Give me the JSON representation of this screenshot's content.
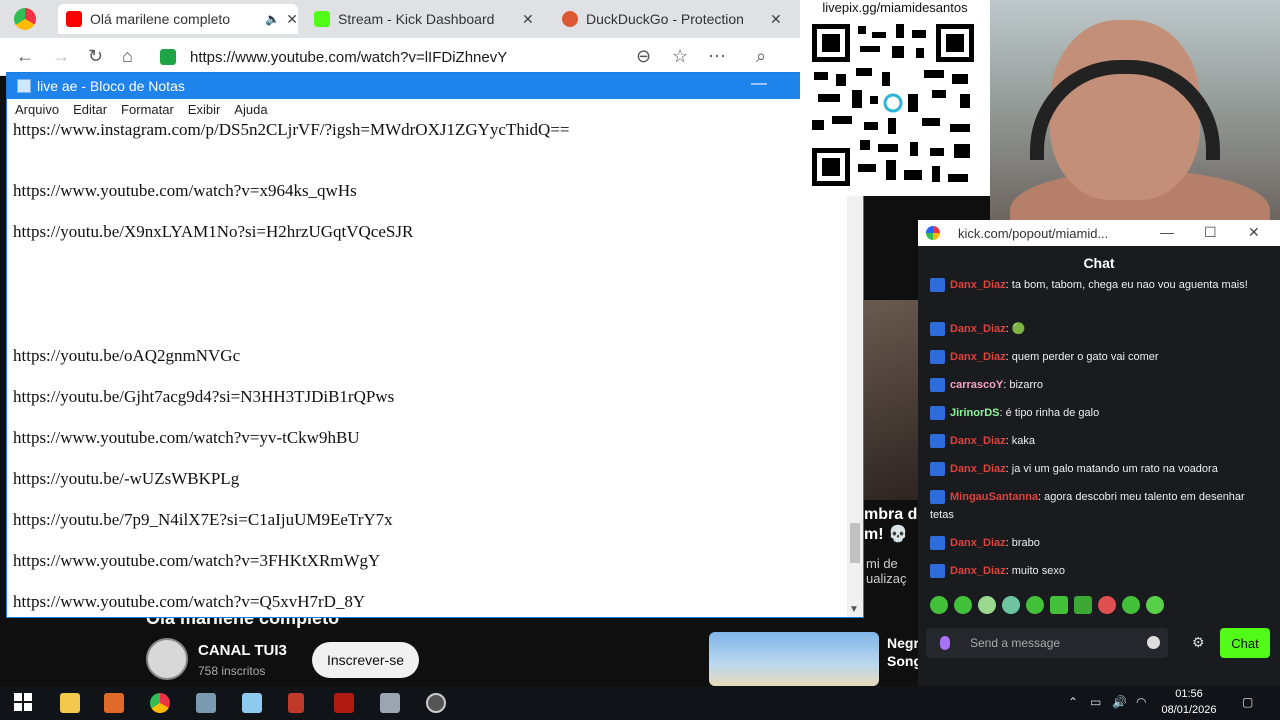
{
  "browser": {
    "tabs": [
      {
        "label": "Olá marilene completo",
        "active": true,
        "icon": "youtube-icon"
      },
      {
        "label": "Stream - Kick Dashboard",
        "active": false,
        "icon": "kick-icon"
      },
      {
        "label": "DuckDuckGo - Protection",
        "active": false,
        "icon": "duckduckgo-icon"
      }
    ],
    "url": "https://www.youtube.com/watch?v=lIFDiZhnevY"
  },
  "notepad": {
    "title": "live ae - Bloco de Notas",
    "menu": [
      "Arquivo",
      "Editar",
      "Formatar",
      "Exibir",
      "Ajuda"
    ],
    "lines": [
      "https://www.instagram.com/p/DS5n2CLjrVF/?igsh=MWdrOXJ1ZGYycThidQ==",
      "",
      "https://www.youtube.com/watch?v=x964ks_qwHs",
      "",
      "https://youtu.be/X9nxLYAM1No?si=H2hrzUGqtVQceSJR",
      "",
      "",
      "",
      "",
      "",
      "https://youtu.be/oAQ2gnmNVGc",
      "",
      "https://youtu.be/Gjht7acg9d4?si=N3HH3TJDiB1rQPws",
      "",
      "https://www.youtube.com/watch?v=yv-tCkw9hBU",
      "",
      "https://youtu.be/-wUZsWBKPLg",
      "",
      "https://youtu.be/7p9_N4ilX7E?si=C1aIjuUM9EeTrY7x",
      "",
      "https://www.youtube.com/watch?v=3FHKtXRmWgY",
      "",
      "https://www.youtube.com/watch?v=Q5xvH7rD_8Y"
    ]
  },
  "overlay": {
    "qr_label": "livepix.gg/miamidesantos"
  },
  "youtube": {
    "video_title": "Olá marilene completo",
    "channel_name": "CANAL TUI3",
    "subscribers": "758 inscritos",
    "subscribe_label": "Inscrever-se",
    "side_title": "mbra de\nm! 💀 ",
    "side_sub": "mi de\nualizaç",
    "rec_title": "Negr\nSong"
  },
  "kick": {
    "window_title": "kick.com/popout/miamid...",
    "chat_header": "Chat",
    "messages": [
      {
        "user": "Danx_Diaz",
        "color": "#e0423c",
        "text": "ta bom, tabom, chega eu nao vou aguenta mais!"
      },
      {
        "user": "Danx_Diaz",
        "color": "#e0423c",
        "text": "🟢"
      },
      {
        "user": "Danx_Diaz",
        "color": "#e0423c",
        "text": "quem perder o gato vai comer"
      },
      {
        "user": "carrascoY",
        "color": "#f5a3c7",
        "text": "bizarro"
      },
      {
        "user": "JirinorDS",
        "color": "#8ef59b",
        "text": "é tipo rinha de galo"
      },
      {
        "user": "Danx_Diaz",
        "color": "#e0423c",
        "text": "kaka"
      },
      {
        "user": "Danx_Diaz",
        "color": "#e0423c",
        "text": "ja vi um galo matando um rato na voadora"
      },
      {
        "user": "MingauSantanna",
        "color": "#e0423c",
        "text": "agora descobri meu talento em desenhar tetas"
      },
      {
        "user": "Danx_Diaz",
        "color": "#e0423c",
        "text": "brabo"
      },
      {
        "user": "Danx_Diaz",
        "color": "#e0423c",
        "text": "muito sexo"
      }
    ],
    "input_placeholder": "Send a message",
    "send_label": "Chat"
  },
  "taskbar": {
    "time": "01:56",
    "date": "08/01/2026"
  }
}
